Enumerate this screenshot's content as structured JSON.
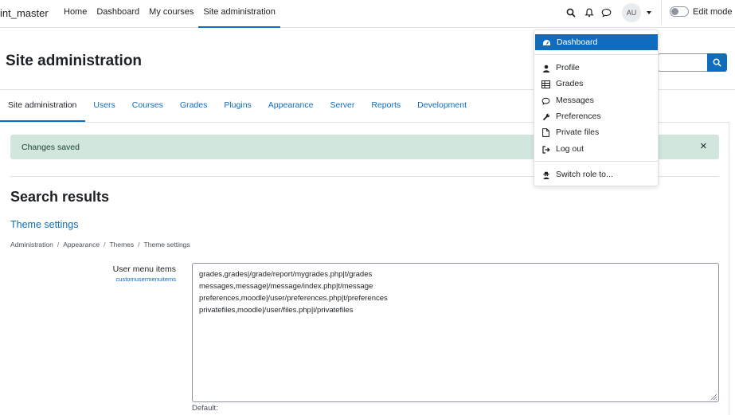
{
  "navbar": {
    "brand": "int_master",
    "items": [
      {
        "label": "Home",
        "active": false
      },
      {
        "label": "Dashboard",
        "active": false
      },
      {
        "label": "My courses",
        "active": false
      },
      {
        "label": "Site administration",
        "active": true
      }
    ],
    "avatar_initials": "AU",
    "edit_mode_label": "Edit mode",
    "edit_mode_on": false
  },
  "header": {
    "title": "Site administration"
  },
  "tabs": [
    {
      "label": "Site administration",
      "active": true
    },
    {
      "label": "Users",
      "active": false
    },
    {
      "label": "Courses",
      "active": false
    },
    {
      "label": "Grades",
      "active": false
    },
    {
      "label": "Plugins",
      "active": false
    },
    {
      "label": "Appearance",
      "active": false
    },
    {
      "label": "Server",
      "active": false
    },
    {
      "label": "Reports",
      "active": false
    },
    {
      "label": "Development",
      "active": false
    }
  ],
  "alert": {
    "message": "Changes saved",
    "close": "×"
  },
  "results": {
    "title": "Search results",
    "section_link": "Theme settings",
    "breadcrumb": [
      "Administration",
      "Appearance",
      "Themes",
      "Theme settings"
    ]
  },
  "setting": {
    "label": "User menu items",
    "key": "customusermenuitems",
    "lines": [
      "grades,grades|/grade/report/mygrades.php|t/grades",
      "messages,message|/message/index.php|t/message",
      "preferences,moodle|/user/preferences.php|t/preferences",
      "privatefiles,moodle|/user/files.php|i/privatefiles"
    ],
    "default_label": "Default:"
  },
  "user_menu": {
    "items": [
      {
        "label": "Dashboard",
        "icon": "dashboard-icon",
        "active": true
      },
      {
        "label": "Profile",
        "icon": "user-icon",
        "active": false
      },
      {
        "label": "Grades",
        "icon": "table-icon",
        "active": false
      },
      {
        "label": "Messages",
        "icon": "comment-icon",
        "active": false
      },
      {
        "label": "Preferences",
        "icon": "wrench-icon",
        "active": false
      },
      {
        "label": "Private files",
        "icon": "file-icon",
        "active": false
      },
      {
        "label": "Log out",
        "icon": "sign-out-icon",
        "active": false
      },
      {
        "label": "Switch role to...",
        "icon": "user-secret-icon",
        "active": false
      }
    ]
  },
  "colors": {
    "primary": "#0f6cbf",
    "success_bg": "#d1e7dd",
    "text": "#1d2125"
  }
}
